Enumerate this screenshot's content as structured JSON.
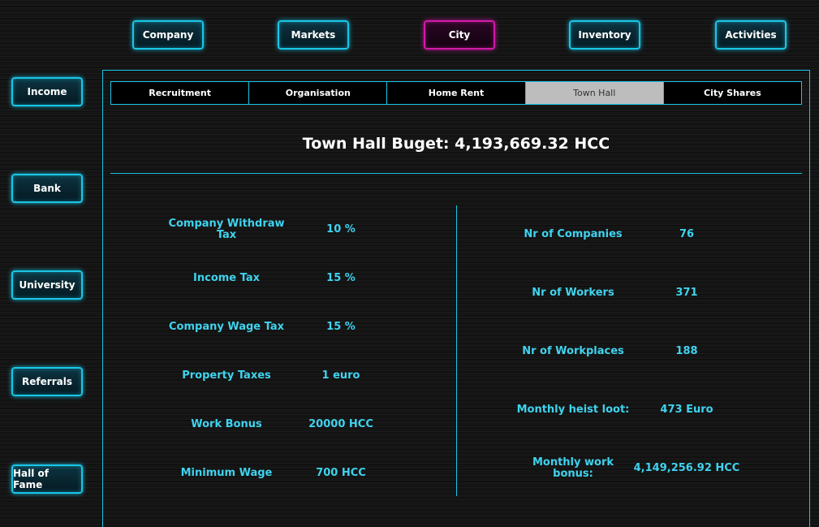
{
  "top_nav": [
    "Company",
    "Markets",
    "City",
    "Inventory",
    "Activities"
  ],
  "side_nav": [
    "Income",
    "Bank",
    "University",
    "Referrals",
    "Hall of Fame"
  ],
  "tabs": [
    "Recruitment",
    "Organisation",
    "Home Rent",
    "Town Hall",
    "City Shares"
  ],
  "active_top": "City",
  "active_tab": "Town Hall",
  "budget_text": "Town Hall Buget: 4,193,669.32 HCC",
  "left_stats": [
    {
      "label": "Company Withdraw Tax",
      "value": "10 %"
    },
    {
      "label": "Income Tax",
      "value": "15 %"
    },
    {
      "label": "Company Wage Tax",
      "value": "15 %"
    },
    {
      "label": "Property Taxes",
      "value": "1 euro"
    },
    {
      "label": "Work Bonus",
      "value": "20000 HCC"
    },
    {
      "label": "Minimum Wage",
      "value": "700 HCC"
    }
  ],
  "right_stats": [
    {
      "label": "Nr of Companies",
      "value": "76"
    },
    {
      "label": "Nr of Workers",
      "value": "371"
    },
    {
      "label": "Nr of Workplaces",
      "value": "188"
    },
    {
      "label": "Monthly heist loot:",
      "value": "473 Euro"
    },
    {
      "label": "Monthly work bonus:",
      "value": "4,149,256.92 HCC"
    }
  ],
  "colors": {
    "accent": "#19c6e6",
    "active": "#d21aa8",
    "stat_text": "#3fd3ee"
  }
}
